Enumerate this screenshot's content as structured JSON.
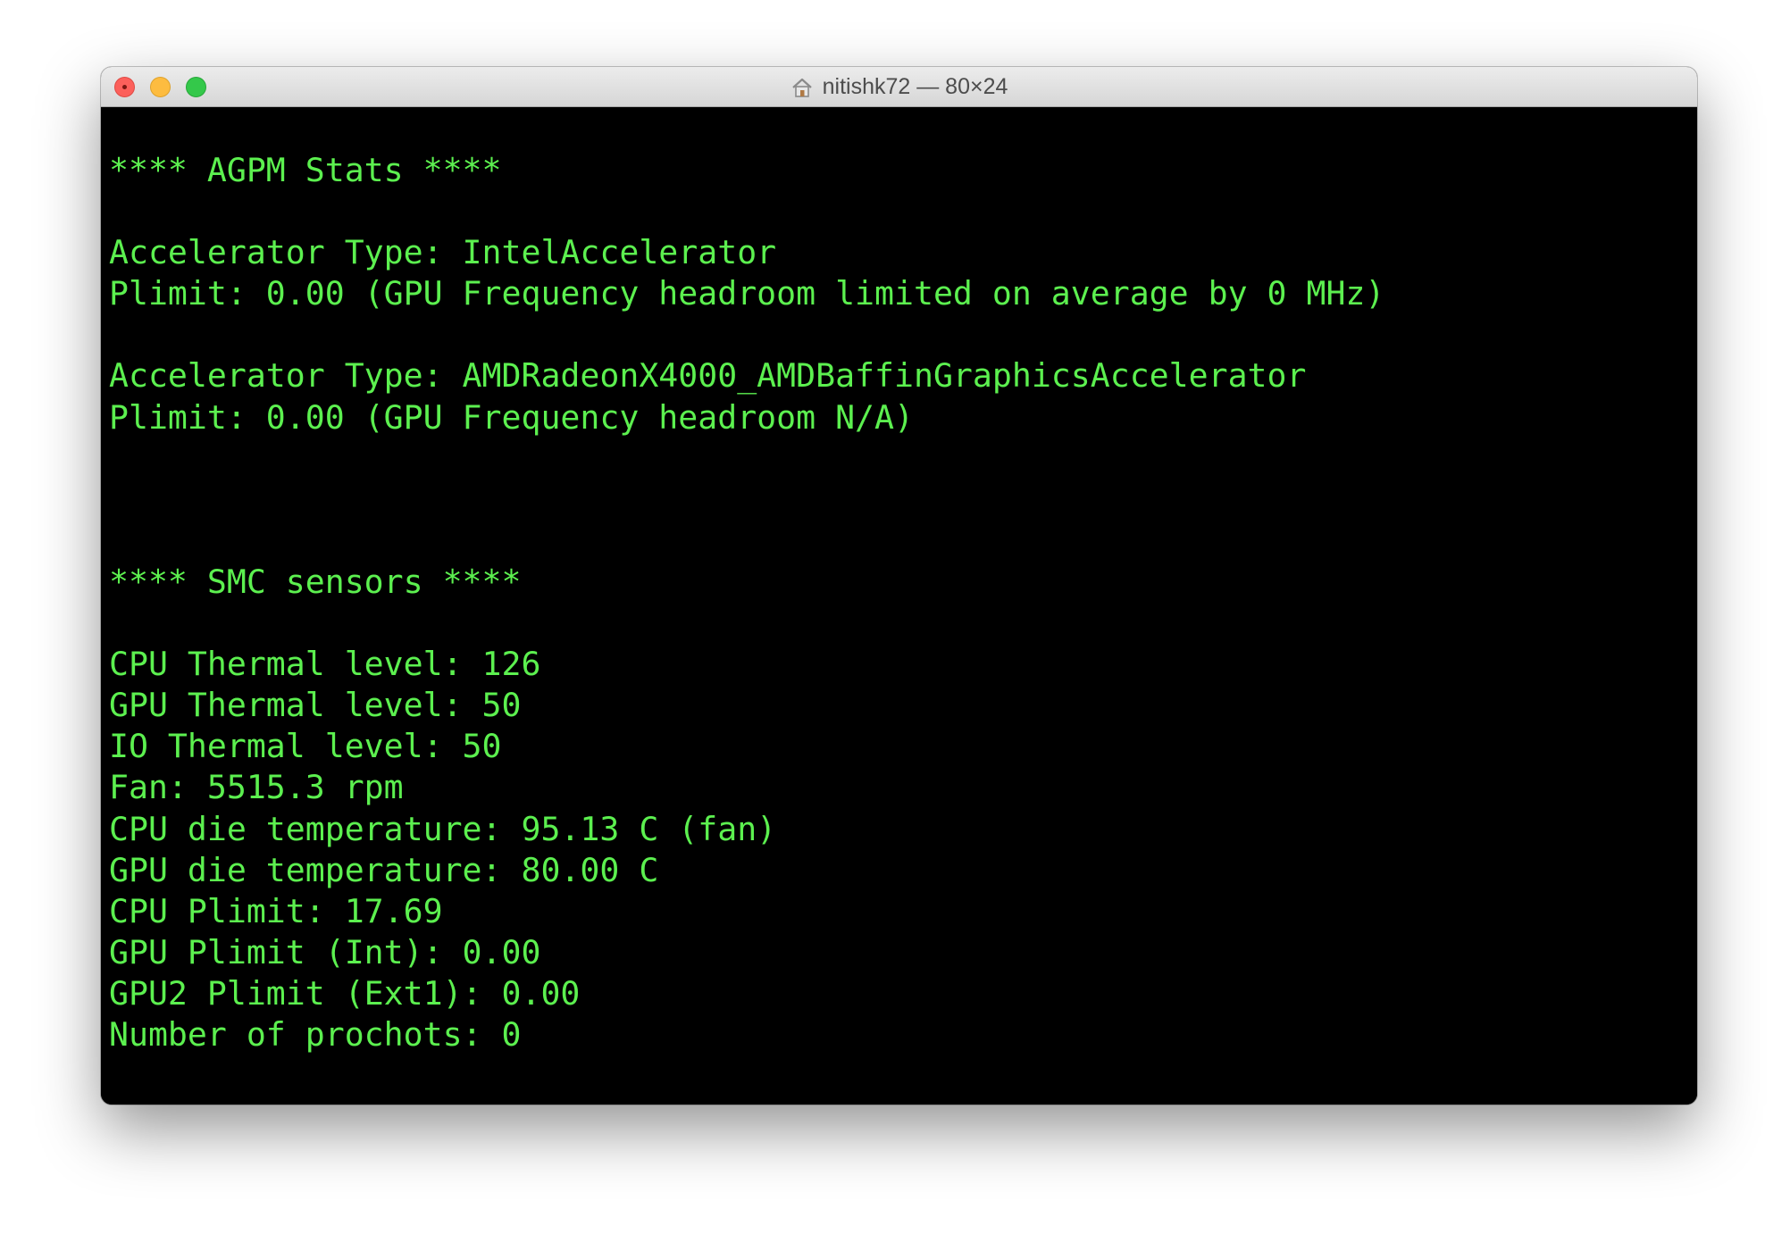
{
  "window": {
    "title": "nitishk72 — 80×24",
    "colors": {
      "terminal_background": "#000000",
      "terminal_text": "#5cf04f",
      "titlebar": "#e3e3e3"
    },
    "icons": {
      "title_icon": "home-folder-icon"
    }
  },
  "terminal": {
    "lines": [
      "**** AGPM Stats ****",
      "",
      "Accelerator Type: IntelAccelerator",
      "Plimit: 0.00 (GPU Frequency headroom limited on average by 0 MHz)",
      "",
      "Accelerator Type: AMDRadeonX4000_AMDBaffinGraphicsAccelerator",
      "Plimit: 0.00 (GPU Frequency headroom N/A)",
      "",
      "",
      "",
      "**** SMC sensors ****",
      "",
      "CPU Thermal level: 126",
      "GPU Thermal level: 50",
      "IO Thermal level: 50",
      "Fan: 5515.3 rpm",
      "CPU die temperature: 95.13 C (fan)",
      "GPU die temperature: 80.00 C",
      "CPU Plimit: 17.69",
      "GPU Plimit (Int): 0.00",
      "GPU2 Plimit (Ext1): 0.00",
      "Number of prochots: 0"
    ]
  }
}
